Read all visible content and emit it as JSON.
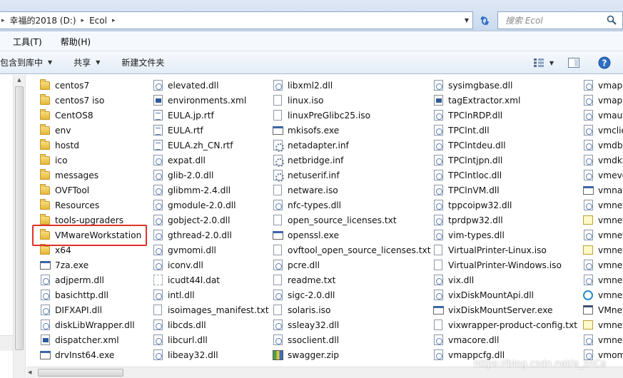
{
  "address": {
    "crumbs": [
      "幸福的2018 (D:)",
      "Ecol"
    ],
    "search_placeholder": "搜索 Ecol"
  },
  "menu": [
    "工具(T)",
    "帮助(H)"
  ],
  "toolbar": {
    "include_library": "包含到库中",
    "share": "共享",
    "new_folder": "新建文件夹"
  },
  "columns": [
    [
      {
        "name": "centos7",
        "icon": "folder"
      },
      {
        "name": "centos7 iso",
        "icon": "folder"
      },
      {
        "name": "CentOS8",
        "icon": "folder"
      },
      {
        "name": "env",
        "icon": "folder"
      },
      {
        "name": "hostd",
        "icon": "folder"
      },
      {
        "name": "ico",
        "icon": "folder"
      },
      {
        "name": "messages",
        "icon": "folder"
      },
      {
        "name": "OVFTool",
        "icon": "folder"
      },
      {
        "name": "Resources",
        "icon": "folder"
      },
      {
        "name": "tools-upgraders",
        "icon": "folder"
      },
      {
        "name": "VMwareWorkstation",
        "icon": "folder"
      },
      {
        "name": "x64",
        "icon": "folder"
      },
      {
        "name": "7za.exe",
        "icon": "exe"
      },
      {
        "name": "adjperm.dll",
        "icon": "dll"
      },
      {
        "name": "basichttp.dll",
        "icon": "dll"
      },
      {
        "name": "DIFXAPI.dll",
        "icon": "dll"
      },
      {
        "name": "diskLibWrapper.dll",
        "icon": "dll"
      },
      {
        "name": "dispatcher.xml",
        "icon": "xml"
      },
      {
        "name": "drvInst64.exe",
        "icon": "exe"
      }
    ],
    [
      {
        "name": "elevated.dll",
        "icon": "dll"
      },
      {
        "name": "environments.xml",
        "icon": "xml"
      },
      {
        "name": "EULA.jp.rtf",
        "icon": "rtf"
      },
      {
        "name": "EULA.rtf",
        "icon": "rtf"
      },
      {
        "name": "EULA.zh_CN.rtf",
        "icon": "rtf"
      },
      {
        "name": "expat.dll",
        "icon": "dll"
      },
      {
        "name": "glib-2.0.dll",
        "icon": "dll"
      },
      {
        "name": "glibmm-2.4.dll",
        "icon": "dll"
      },
      {
        "name": "gmodule-2.0.dll",
        "icon": "dll"
      },
      {
        "name": "gobject-2.0.dll",
        "icon": "dll"
      },
      {
        "name": "gthread-2.0.dll",
        "icon": "dll"
      },
      {
        "name": "gvmomi.dll",
        "icon": "dll"
      },
      {
        "name": "iconv.dll",
        "icon": "dll"
      },
      {
        "name": "icudt44l.dat",
        "icon": "dat"
      },
      {
        "name": "intl.dll",
        "icon": "dll"
      },
      {
        "name": "isoimages_manifest.txt",
        "icon": "doc"
      },
      {
        "name": "libcds.dll",
        "icon": "dll"
      },
      {
        "name": "libcurl.dll",
        "icon": "dll"
      },
      {
        "name": "libeay32.dll",
        "icon": "dll"
      }
    ],
    [
      {
        "name": "libxml2.dll",
        "icon": "dll"
      },
      {
        "name": "linux.iso",
        "icon": "doc"
      },
      {
        "name": "linuxPreGlibc25.iso",
        "icon": "doc"
      },
      {
        "name": "mkisofs.exe",
        "icon": "exe"
      },
      {
        "name": "netadapter.inf",
        "icon": "inf"
      },
      {
        "name": "netbridge.inf",
        "icon": "inf"
      },
      {
        "name": "netuserif.inf",
        "icon": "inf"
      },
      {
        "name": "netware.iso",
        "icon": "doc"
      },
      {
        "name": "nfc-types.dll",
        "icon": "dll"
      },
      {
        "name": "open_source_licenses.txt",
        "icon": "doc"
      },
      {
        "name": "openssl.exe",
        "icon": "exe"
      },
      {
        "name": "ovftool_open_source_licenses.txt",
        "icon": "doc"
      },
      {
        "name": "pcre.dll",
        "icon": "dll"
      },
      {
        "name": "readme.txt",
        "icon": "doc"
      },
      {
        "name": "sigc-2.0.dll",
        "icon": "dll"
      },
      {
        "name": "solaris.iso",
        "icon": "doc"
      },
      {
        "name": "ssleay32.dll",
        "icon": "dll"
      },
      {
        "name": "ssoclient.dll",
        "icon": "dll"
      },
      {
        "name": "swagger.zip",
        "icon": "zip"
      }
    ],
    [
      {
        "name": "sysimgbase.dll",
        "icon": "dll"
      },
      {
        "name": "tagExtractor.xml",
        "icon": "xml"
      },
      {
        "name": "TPClnRDP.dll",
        "icon": "dll"
      },
      {
        "name": "TPClnt.dll",
        "icon": "dll"
      },
      {
        "name": "TPClntdeu.dll",
        "icon": "dll"
      },
      {
        "name": "TPClntjpn.dll",
        "icon": "dll"
      },
      {
        "name": "TPClntloc.dll",
        "icon": "dll"
      },
      {
        "name": "TPClnVM.dll",
        "icon": "dll"
      },
      {
        "name": "tppcoipw32.dll",
        "icon": "dll"
      },
      {
        "name": "tprdpw32.dll",
        "icon": "dll"
      },
      {
        "name": "vim-types.dll",
        "icon": "dll"
      },
      {
        "name": "VirtualPrinter-Linux.iso",
        "icon": "doc"
      },
      {
        "name": "VirtualPrinter-Windows.iso",
        "icon": "doc"
      },
      {
        "name": "vix.dll",
        "icon": "dll"
      },
      {
        "name": "vixDiskMountApi.dll",
        "icon": "dll"
      },
      {
        "name": "vixDiskMountServer.exe",
        "icon": "exe"
      },
      {
        "name": "vixwrapper-product-config.txt",
        "icon": "doc"
      },
      {
        "name": "vmacore.dll",
        "icon": "dll"
      },
      {
        "name": "vmappcfg.dll",
        "icon": "dll"
      }
    ],
    [
      {
        "name": "vmapp",
        "icon": "dll"
      },
      {
        "name": "vmapp",
        "icon": "dll"
      },
      {
        "name": "vmautl",
        "icon": "dll"
      },
      {
        "name": "vmclie",
        "icon": "dll"
      },
      {
        "name": "vmdbC",
        "icon": "dll"
      },
      {
        "name": "vmdkS",
        "icon": "dll"
      },
      {
        "name": "vmeve",
        "icon": "dll"
      },
      {
        "name": "vmnat.",
        "icon": "exe"
      },
      {
        "name": "vmnet.",
        "icon": "dll"
      },
      {
        "name": "vmneta",
        "icon": "ovf"
      },
      {
        "name": "vmneta",
        "icon": "dll"
      },
      {
        "name": "vmnetl",
        "icon": "ovf"
      },
      {
        "name": "vmnetl",
        "icon": "dll"
      },
      {
        "name": "vmnetl",
        "icon": "dll"
      },
      {
        "name": "vmneto",
        "icon": "globe"
      },
      {
        "name": "VMnet",
        "icon": "mgr"
      },
      {
        "name": "vmnetu",
        "icon": "ovf"
      },
      {
        "name": "vmnetu",
        "icon": "dll"
      },
      {
        "name": "vmom",
        "icon": "dll"
      }
    ]
  ],
  "watermark": "https://blog.csdn.net/a_znCa"
}
